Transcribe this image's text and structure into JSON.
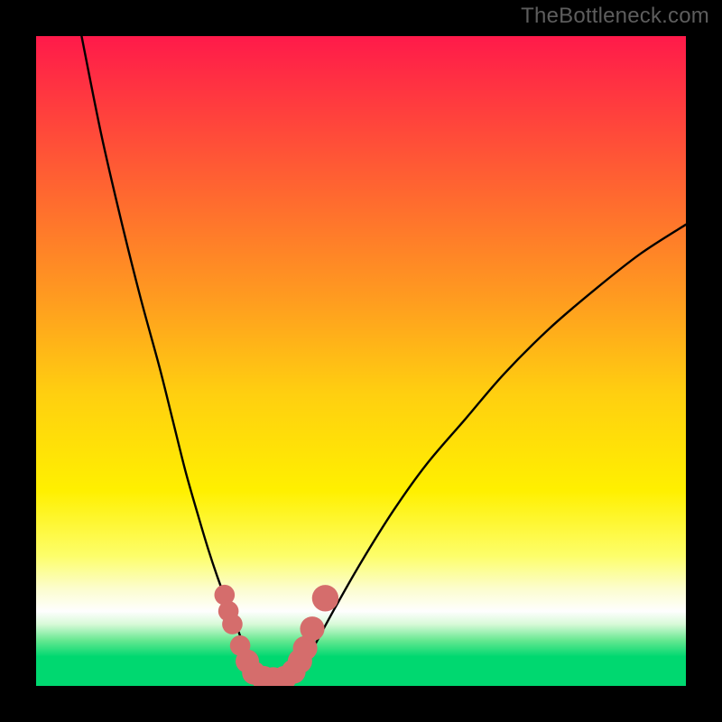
{
  "watermark": "TheBottleneck.com",
  "colors": {
    "frame": "#000000",
    "watermark": "#5d5d5d",
    "curve": "#000000",
    "markers": "#d56d6c",
    "gradient_stops": [
      {
        "offset": 0.0,
        "color": "#ff1a4a"
      },
      {
        "offset": 0.1,
        "color": "#ff3a3f"
      },
      {
        "offset": 0.25,
        "color": "#ff6a2f"
      },
      {
        "offset": 0.4,
        "color": "#ff9a20"
      },
      {
        "offset": 0.55,
        "color": "#ffcf10"
      },
      {
        "offset": 0.7,
        "color": "#fff000"
      },
      {
        "offset": 0.8,
        "color": "#fdfe6a"
      },
      {
        "offset": 0.85,
        "color": "#fcfdcd"
      },
      {
        "offset": 0.885,
        "color": "#fefefe"
      },
      {
        "offset": 0.905,
        "color": "#d8fad8"
      },
      {
        "offset": 0.93,
        "color": "#66e891"
      },
      {
        "offset": 0.955,
        "color": "#00d870"
      },
      {
        "offset": 1.0,
        "color": "#00d870"
      }
    ]
  },
  "chart_data": {
    "type": "line",
    "title": "",
    "xlabel": "",
    "ylabel": "",
    "x_range": [
      0,
      100
    ],
    "y_range": [
      0,
      100
    ],
    "series": [
      {
        "name": "left-branch",
        "x": [
          7,
          10,
          13,
          16,
          19,
          21,
          23,
          25,
          26.5,
          28,
          29.5,
          31,
          32,
          33,
          33.8,
          34.5
        ],
        "y": [
          100,
          85,
          72,
          60,
          49,
          41,
          33,
          26,
          21,
          16.5,
          12.5,
          8.8,
          6.0,
          3.6,
          2.0,
          1.0
        ]
      },
      {
        "name": "right-branch",
        "x": [
          39.5,
          41,
          43,
          46,
          50,
          55,
          60,
          66,
          72,
          79,
          86,
          93,
          100
        ],
        "y": [
          1.0,
          3.0,
          6.5,
          12,
          19,
          27,
          34,
          41,
          48,
          55,
          61,
          66.5,
          71
        ]
      },
      {
        "name": "valley-floor",
        "x": [
          34.5,
          36,
          37.5,
          39.5
        ],
        "y": [
          1.0,
          0.4,
          0.4,
          1.0
        ]
      }
    ],
    "markers": {
      "name": "datapoints",
      "points": [
        {
          "x": 29.0,
          "y": 14.0,
          "r": 1.3
        },
        {
          "x": 29.6,
          "y": 11.5,
          "r": 1.3
        },
        {
          "x": 30.2,
          "y": 9.5,
          "r": 1.3
        },
        {
          "x": 31.4,
          "y": 6.2,
          "r": 1.3
        },
        {
          "x": 32.5,
          "y": 3.8,
          "r": 1.6
        },
        {
          "x": 33.5,
          "y": 2.0,
          "r": 1.6
        },
        {
          "x": 35.0,
          "y": 1.2,
          "r": 1.7
        },
        {
          "x": 36.5,
          "y": 1.0,
          "r": 1.7
        },
        {
          "x": 38.2,
          "y": 1.2,
          "r": 1.7
        },
        {
          "x": 39.6,
          "y": 2.2,
          "r": 1.7
        },
        {
          "x": 40.6,
          "y": 3.8,
          "r": 1.7
        },
        {
          "x": 41.4,
          "y": 5.8,
          "r": 1.7
        },
        {
          "x": 42.5,
          "y": 8.8,
          "r": 1.7
        },
        {
          "x": 44.5,
          "y": 13.5,
          "r": 1.9
        }
      ]
    }
  }
}
